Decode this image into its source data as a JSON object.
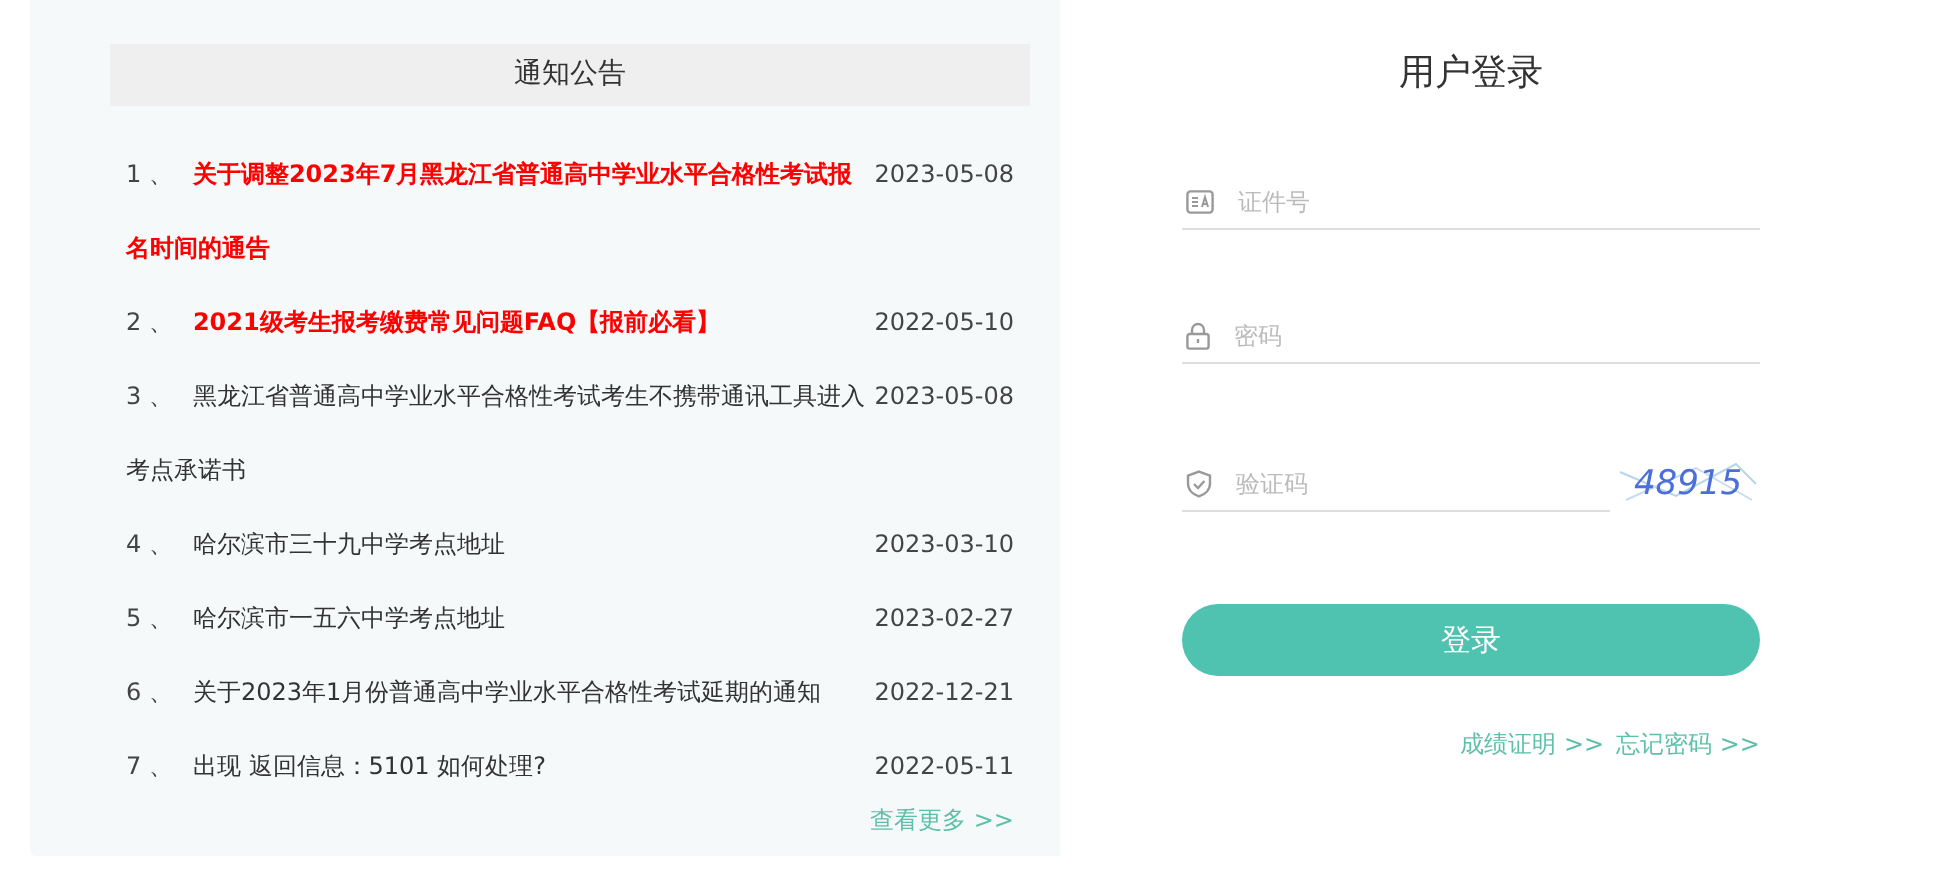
{
  "notices": {
    "title": "通知公告",
    "items": [
      {
        "number": "1 、",
        "title": "关于调整2023年7月黑龙江省普通高中学业水平合格性考试报名时间的通告",
        "date": "2023-05-08",
        "highlight": true
      },
      {
        "number": "2 、",
        "title": "2021级考生报考缴费常见问题FAQ【报前必看】",
        "date": "2022-05-10",
        "highlight": true
      },
      {
        "number": "3 、",
        "title": "黑龙江省普通高中学业水平合格性考试考生不携带通讯工具进入考点承诺书",
        "date": "2023-05-08",
        "highlight": false
      },
      {
        "number": "4 、",
        "title": "哈尔滨市三十九中学考点地址",
        "date": "2023-03-10",
        "highlight": false
      },
      {
        "number": "5 、",
        "title": "哈尔滨市一五六中学考点地址",
        "date": "2023-02-27",
        "highlight": false
      },
      {
        "number": "6 、",
        "title": "关于2023年1月份普通高中学业水平合格性考试延期的通知",
        "date": "2022-12-21",
        "highlight": false
      },
      {
        "number": "7 、",
        "title": "出现 返回信息：5101 如何处理?",
        "date": "2022-05-11",
        "highlight": false
      }
    ],
    "more_link": "查看更多 >>"
  },
  "login": {
    "title": "用户登录",
    "fields": [
      {
        "kind": "id",
        "placeholder": "证件号"
      },
      {
        "kind": "password",
        "placeholder": "密码"
      },
      {
        "kind": "captcha",
        "placeholder": "验证码",
        "captcha": "48915"
      }
    ],
    "submit": "登录",
    "links": [
      "成绩证明 >>",
      "忘记密码 >>"
    ]
  }
}
